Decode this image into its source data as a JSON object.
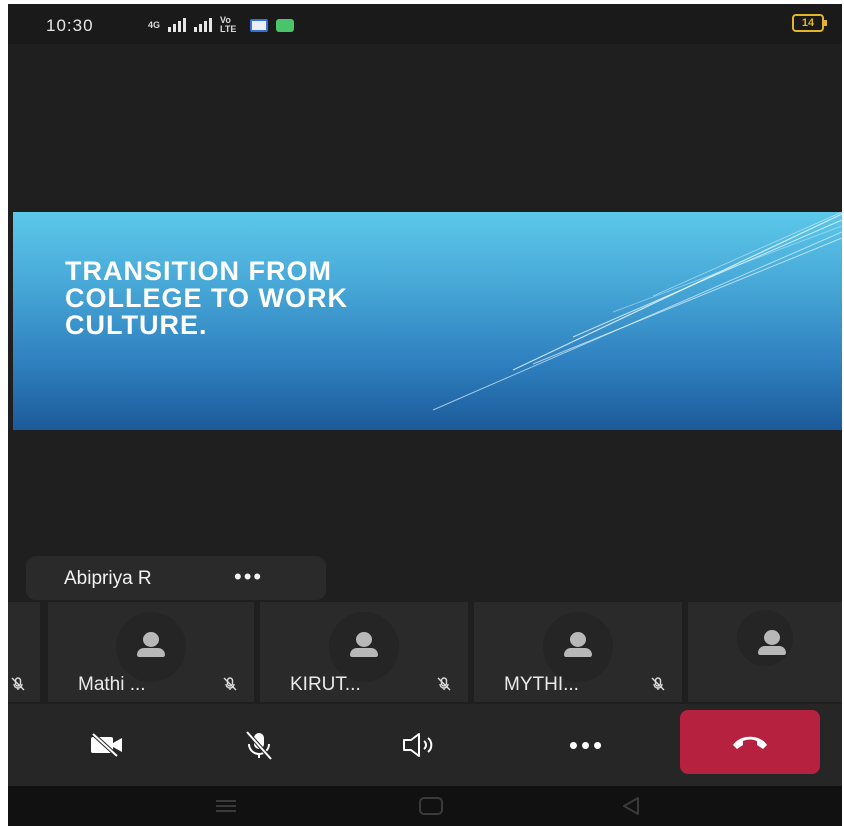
{
  "status_bar": {
    "time": "10:30",
    "network_label": "4G",
    "volte_label": "Vo LTE",
    "battery": "14"
  },
  "slide": {
    "title": "TRANSITION FROM\nCOLLEGE TO WORK\nCULTURE."
  },
  "presenter": {
    "name": "Abipriya R",
    "more": "•••"
  },
  "participants": [
    {
      "name": "Mathi ..."
    },
    {
      "name": "KIRUT..."
    },
    {
      "name": "MYTHI..."
    },
    {
      "name": ""
    }
  ],
  "toolbar": {
    "more_label": "•••",
    "buttons": [
      "camera-off-icon",
      "mic-off-icon",
      "speaker-icon",
      "more-icon",
      "hang-up-icon"
    ]
  },
  "colors": {
    "background": "#1f1f1f",
    "tile": "#2a2a2a",
    "hangup": "#b5213f",
    "battery": "#e0b52a"
  }
}
